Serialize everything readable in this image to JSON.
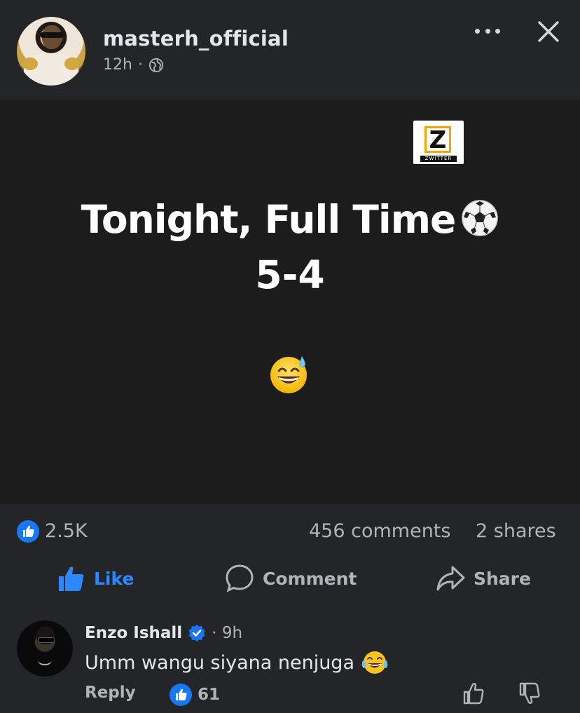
{
  "post": {
    "username": "masterh_official",
    "time": "12h",
    "separator": "·",
    "line1": "Tonight, Full Time",
    "line2": "5-4",
    "watermark_text": "ZWITTER",
    "watermark_letter": "Z"
  },
  "stats": {
    "likes": "2.5K",
    "comments": "456 comments",
    "shares": "2 shares"
  },
  "actions": {
    "like": "Like",
    "comment": "Comment",
    "share": "Share"
  },
  "comment": {
    "author": "Enzo Ishall",
    "time": "· 9h",
    "text": "Umm wangu siyana nenjuga",
    "reply_label": "Reply",
    "reaction_count": "61"
  },
  "colors": {
    "background": "#242526",
    "post_background": "#1c1c1d",
    "accent_blue": "#2d88ff",
    "text_primary": "#e4e6eb",
    "text_secondary": "#b0b3b8"
  },
  "icons": [
    "globe-icon",
    "more-icon",
    "close-icon",
    "soccer-ball-icon",
    "sweat-smile-emoji",
    "like-reaction-icon",
    "thumbs-up-icon",
    "comment-icon",
    "share-icon",
    "verified-icon",
    "laugh-emoji",
    "thumbs-down-icon"
  ]
}
